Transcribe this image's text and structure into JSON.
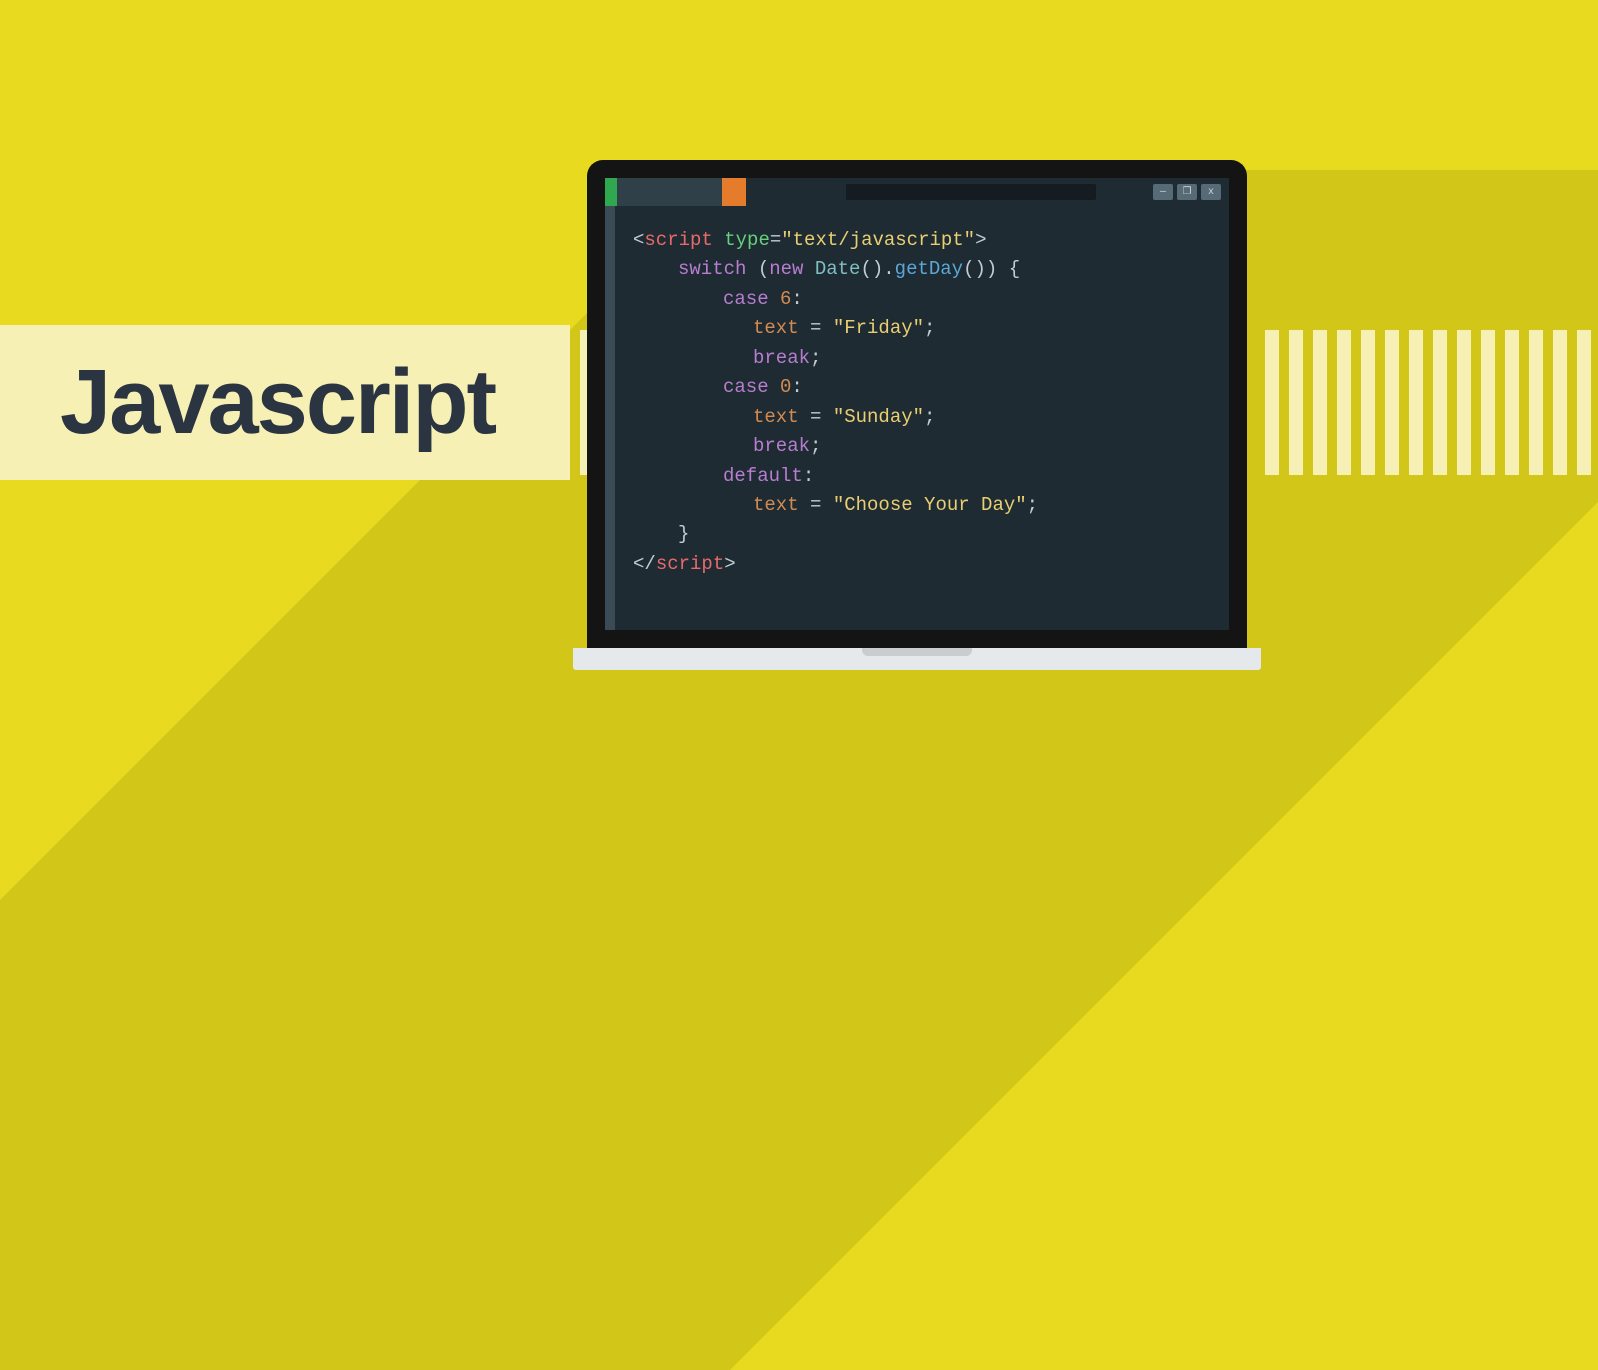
{
  "title": "Javascript",
  "window_controls": {
    "minimize": "—",
    "maximize": "❐",
    "close": "x"
  },
  "code": {
    "open_tag": {
      "lt": "<",
      "tag": "script",
      "attr": "type",
      "eq": "=",
      "val": "\"text/javascript\"",
      "gt": ">"
    },
    "switch_line": {
      "kw": "switch",
      "paren_open": " (",
      "new": "new ",
      "cls": "Date",
      "call": "().",
      "method": "getDay",
      "after": "()) {"
    },
    "case1": {
      "kw": "case ",
      "num": "6",
      "colon": ":"
    },
    "text1": {
      "id": "text",
      "eq": " = ",
      "str": "\"Friday\"",
      "semi": ";"
    },
    "break1": {
      "kw": "break",
      "semi": ";"
    },
    "case2": {
      "kw": "case ",
      "num": "0",
      "colon": ":"
    },
    "text2": {
      "id": "text",
      "eq": " = ",
      "str": "\"Sunday\"",
      "semi": ";"
    },
    "break2": {
      "kw": "break",
      "semi": ";"
    },
    "default": {
      "kw": "default",
      "colon": ":"
    },
    "text3": {
      "id": "text",
      "eq": " = ",
      "str": "\"Choose Your Day\"",
      "semi": ";"
    },
    "close_brace": "}",
    "close_tag": {
      "lt": "</",
      "tag": "script",
      "gt": ">"
    }
  }
}
